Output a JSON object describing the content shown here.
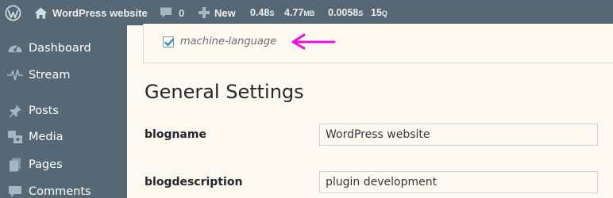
{
  "admin_bar": {
    "wp_logo_icon": "wordpress-logo-icon",
    "site_icon": "home-icon",
    "site_name": "WordPress website",
    "comments_icon": "comment-bubble-icon",
    "comments_count": "0",
    "new_icon": "plus-icon",
    "new_label": "New",
    "stats": [
      {
        "value": "0.48",
        "unit": "S"
      },
      {
        "value": "4.77",
        "unit": "MB"
      },
      {
        "value": "0.0058",
        "unit": "S"
      },
      {
        "value": "15",
        "unit": "Q"
      }
    ]
  },
  "sidebar": {
    "items": [
      {
        "icon": "dashboard-icon",
        "label": "Dashboard"
      },
      {
        "icon": "stream-icon",
        "label": "Stream"
      },
      {
        "icon": "pin-icon",
        "label": "Posts"
      },
      {
        "icon": "media-icon",
        "label": "Media"
      },
      {
        "icon": "pages-icon",
        "label": "Pages"
      },
      {
        "icon": "comments-icon",
        "label": "Comments"
      }
    ]
  },
  "notice": {
    "checkbox_checked": true,
    "checkbox_label": "machine-language",
    "arrow_color": "#ee10d6"
  },
  "main": {
    "title": "General Settings",
    "rows": [
      {
        "label": "blogname",
        "value": "WordPress website"
      },
      {
        "label": "blogdescription",
        "value": "plugin development"
      }
    ]
  },
  "colors": {
    "admin_bar_bg": "#566875",
    "sidebar_bg": "#566875",
    "content_bg": "#fdf9f0",
    "checkbox_check": "#1e8cbe"
  }
}
